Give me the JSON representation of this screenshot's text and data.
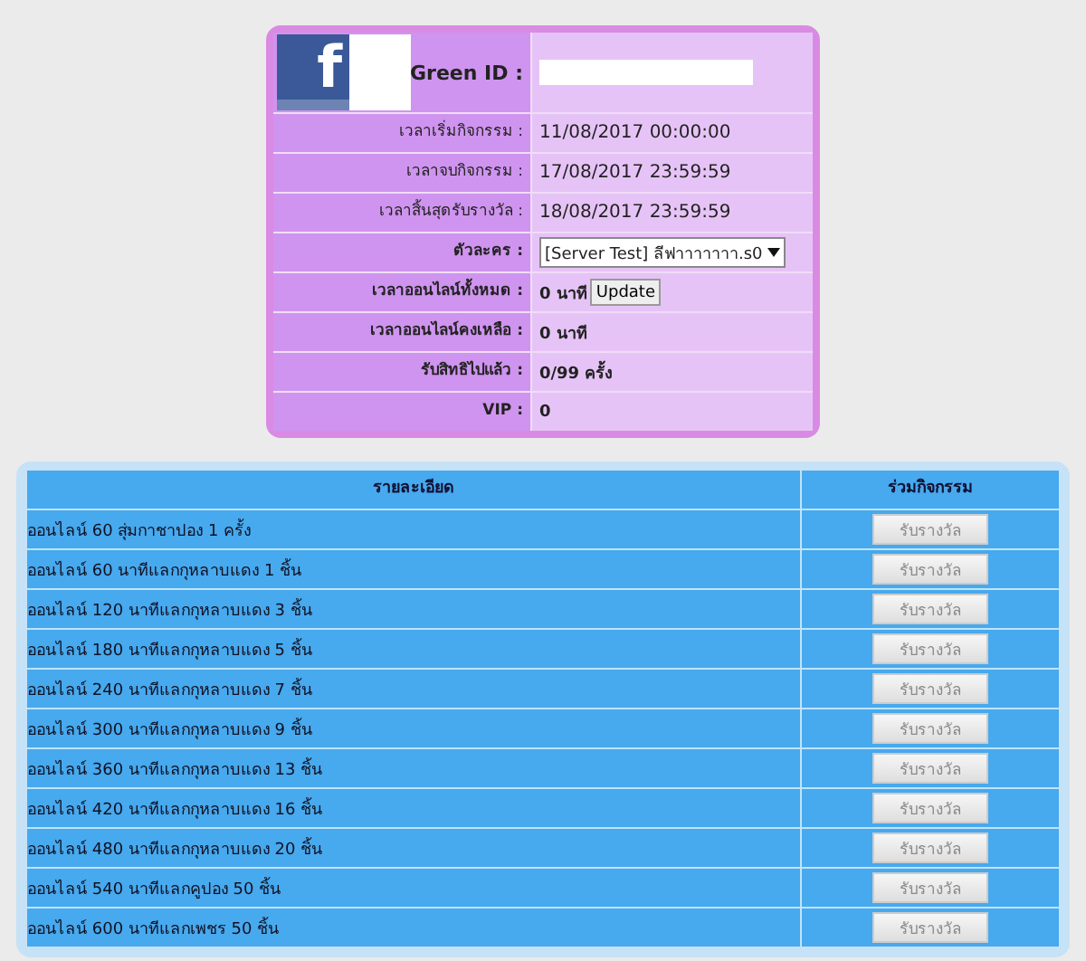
{
  "profile": {
    "logo_letter": "f",
    "id_label": "Green ID :",
    "rows": [
      {
        "kind": "text",
        "label": "เวลาเริ่มกิจกรรม :",
        "bold": false,
        "value": "11/08/2017 00:00:00"
      },
      {
        "kind": "text",
        "label": "เวลาจบกิจกรรม :",
        "bold": false,
        "value": "17/08/2017 23:59:59"
      },
      {
        "kind": "text",
        "label": "เวลาสิ้นสุดรับรางวัล :",
        "bold": false,
        "value": "18/08/2017 23:59:59"
      },
      {
        "kind": "select",
        "label": "ตัวละคร :",
        "bold": true,
        "value": "[Server Test] ลีฟาาาาาาา.s0"
      },
      {
        "kind": "button",
        "label": "เวลาออนไลน์ทั้งหมด :",
        "bold": true,
        "value": "0 นาที",
        "button": "Update"
      },
      {
        "kind": "text",
        "label": "เวลาออนไลน์คงเหลือ :",
        "bold": true,
        "value": "0 นาที"
      },
      {
        "kind": "text",
        "label": "รับสิทธิไปแล้ว :",
        "bold": true,
        "value": "0/99 ครั้ง"
      },
      {
        "kind": "text",
        "label": "VIP :",
        "bold": true,
        "value": "0"
      }
    ]
  },
  "rewards": {
    "columns": [
      "รายละเอียด",
      "ร่วมกิจกรรม"
    ],
    "rows": [
      {
        "detail": "ออนไลน์ 60 สุ่มกาชาปอง 1 ครั้ง",
        "button": "รับรางวัล",
        "disabled": true
      },
      {
        "detail": "ออนไลน์ 60 นาทีแลกกุหลาบแดง 1 ชิ้น",
        "button": "รับรางวัล",
        "disabled": true
      },
      {
        "detail": "ออนไลน์ 120 นาทีแลกกุหลาบแดง 3 ชิ้น",
        "button": "รับรางวัล",
        "disabled": true
      },
      {
        "detail": "ออนไลน์ 180 นาทีแลกกุหลาบแดง 5 ชิ้น",
        "button": "รับรางวัล",
        "disabled": true
      },
      {
        "detail": "ออนไลน์ 240 นาทีแลกกุหลาบแดง 7 ชิ้น",
        "button": "รับรางวัล",
        "disabled": true
      },
      {
        "detail": "ออนไลน์ 300 นาทีแลกกุหลาบแดง 9 ชิ้น",
        "button": "รับรางวัล",
        "disabled": true
      },
      {
        "detail": "ออนไลน์ 360 นาทีแลกกุหลาบแดง 13 ชิ้น",
        "button": "รับรางวัล",
        "disabled": true
      },
      {
        "detail": "ออนไลน์ 420 นาทีแลกกุหลาบแดง 16 ชิ้น",
        "button": "รับรางวัล",
        "disabled": true
      },
      {
        "detail": "ออนไลน์ 480 นาทีแลกกุหลาบแดง 20 ชิ้น",
        "button": "รับรางวัล",
        "disabled": true
      },
      {
        "detail": "ออนไลน์ 540 นาทีแลกคูปอง 50 ชิ้น",
        "button": "รับรางวัล",
        "disabled": true
      },
      {
        "detail": "ออนไลน์ 600 นาทีแลกเพชร 50 ชิ้น",
        "button": "รับรางวัล",
        "disabled": true
      }
    ]
  }
}
